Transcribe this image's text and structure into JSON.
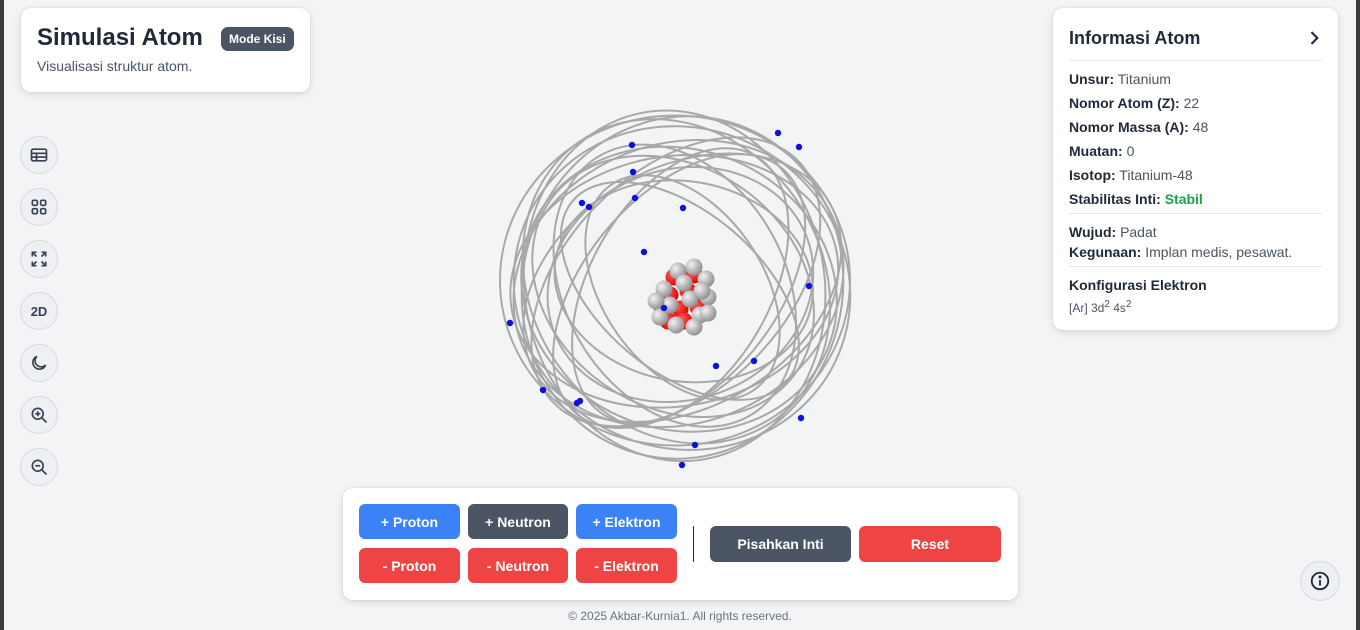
{
  "title_card": {
    "title": "Simulasi Atom",
    "badge": "Mode Kisi",
    "subtitle": "Visualisasi struktur atom."
  },
  "toolbar": [
    {
      "icon": "table-icon"
    },
    {
      "icon": "grid-icon"
    },
    {
      "icon": "expand-icon"
    },
    {
      "icon": "2d-toggle",
      "label": "2D"
    },
    {
      "icon": "moon-icon"
    },
    {
      "icon": "zoom-in-icon"
    },
    {
      "icon": "zoom-out-icon"
    }
  ],
  "info": {
    "header": "Informasi Atom",
    "rows": [
      {
        "label": "Unsur:",
        "value": "Titanium"
      },
      {
        "label": "Nomor Atom (Z):",
        "value": "22"
      },
      {
        "label": "Nomor Massa (A):",
        "value": "48"
      },
      {
        "label": "Muatan:",
        "value": "0"
      },
      {
        "label": "Isotop:",
        "value": "Titanium-48"
      },
      {
        "label": "Stabilitas Inti:",
        "value": "Stabil"
      }
    ],
    "extra": [
      {
        "label": "Wujud:",
        "value": "Padat"
      },
      {
        "label": "Kegunaan:",
        "value": "Implan medis, pesawat."
      }
    ],
    "config_title": "Konfigurasi Elektron",
    "config": {
      "core": "[Ar] 3d",
      "e1": "2",
      "mid": " 4s",
      "e2": "2"
    }
  },
  "controls": {
    "add_proton": "+ Proton",
    "add_neutron": "+ Neutron",
    "add_electron": "+ Elektron",
    "remove_proton": "- Proton",
    "remove_neutron": "- Neutron",
    "remove_electron": "- Elektron",
    "split": "Pisahkan Inti",
    "reset": "Reset"
  },
  "footer": "© 2025 Akbar-Kurnia1. All rights reserved.",
  "colors": {
    "proton": "#ff1a1a",
    "neutron": "#b5b5b5",
    "electron": "#1010dd",
    "orbit": "#a8a8a8"
  }
}
